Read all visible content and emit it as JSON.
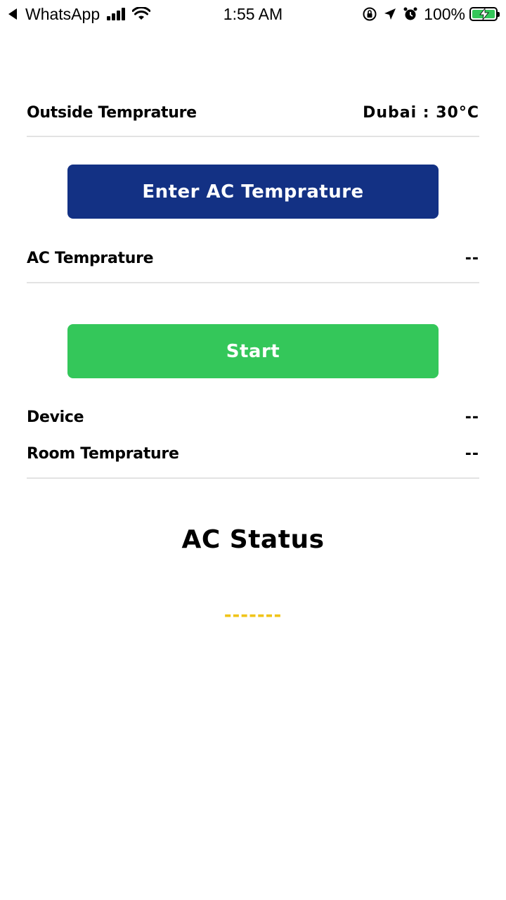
{
  "status_bar": {
    "back_app": "WhatsApp",
    "time": "1:55 AM",
    "battery": "100%",
    "icons": [
      "back-arrow-icon",
      "cellular-signal-icon",
      "wifi-icon",
      "orientation-lock-icon",
      "location-arrow-icon",
      "alarm-icon",
      "battery-charging-icon"
    ]
  },
  "outside": {
    "label": "Outside Temprature",
    "value": "Dubai : 30°C"
  },
  "enter_button": {
    "label": "Enter AC Temprature",
    "color": "#133184"
  },
  "ac_temp": {
    "label": "AC Temprature",
    "value": "--"
  },
  "start_button": {
    "label": "Start",
    "color": "#34c75a"
  },
  "device": {
    "label": "Device",
    "value": "--"
  },
  "room_temp": {
    "label": "Room Temprature",
    "value": "--"
  },
  "ac_status": {
    "title": "AC Status",
    "value": "-------",
    "value_color": "#f0c419"
  }
}
